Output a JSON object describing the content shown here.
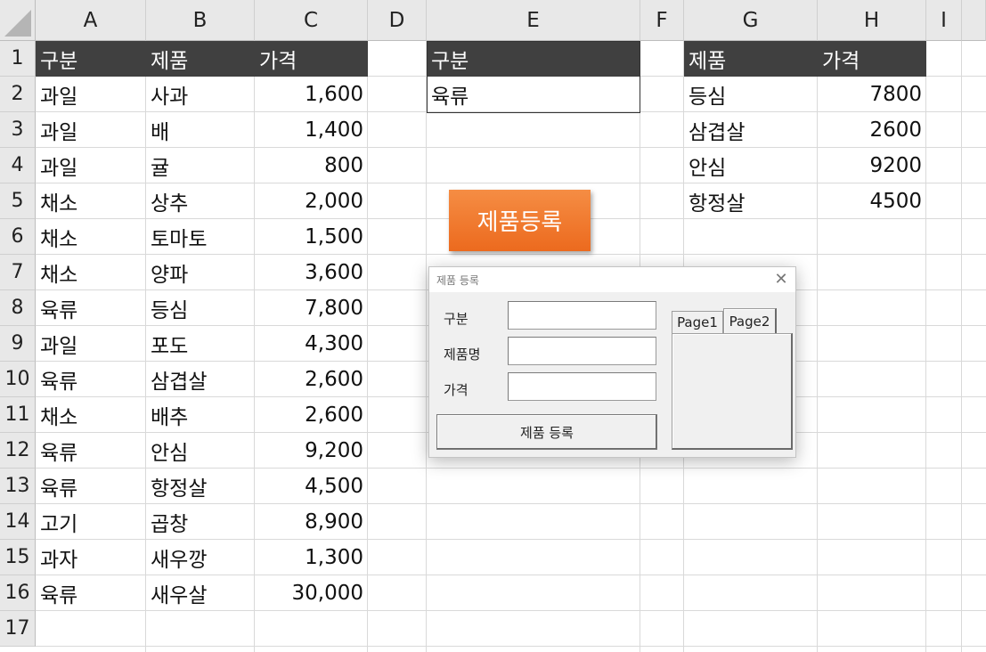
{
  "columns": [
    "A",
    "B",
    "C",
    "D",
    "E",
    "F",
    "G",
    "H",
    "I"
  ],
  "rows": [
    "1",
    "2",
    "3",
    "4",
    "5",
    "6",
    "7",
    "8",
    "9",
    "10",
    "11",
    "12",
    "13",
    "14",
    "15",
    "16",
    "17"
  ],
  "table_main": {
    "headers": [
      "구분",
      "제품",
      "가격"
    ],
    "rows": [
      [
        "과일",
        "사과",
        "1,600"
      ],
      [
        "과일",
        "배",
        "1,400"
      ],
      [
        "과일",
        "귤",
        "800"
      ],
      [
        "채소",
        "상추",
        "2,000"
      ],
      [
        "채소",
        "토마토",
        "1,500"
      ],
      [
        "채소",
        "양파",
        "3,600"
      ],
      [
        "육류",
        "등심",
        "7,800"
      ],
      [
        "과일",
        "포도",
        "4,300"
      ],
      [
        "육류",
        "삼겹살",
        "2,600"
      ],
      [
        "채소",
        "배추",
        "2,600"
      ],
      [
        "육류",
        "안심",
        "9,200"
      ],
      [
        "육류",
        "항정살",
        "4,500"
      ],
      [
        "고기",
        "곱창",
        "8,900"
      ],
      [
        "과자",
        "새우깡",
        "1,300"
      ],
      [
        "육류",
        "새우살",
        "30,000"
      ]
    ]
  },
  "criteria": {
    "header": "구분",
    "value": "육류"
  },
  "result": {
    "headers": [
      "제품",
      "가격"
    ],
    "rows": [
      [
        "등심",
        "7800"
      ],
      [
        "삼겹살",
        "2600"
      ],
      [
        "안심",
        "9200"
      ],
      [
        "항정살",
        "4500"
      ]
    ]
  },
  "macro_button": {
    "label": "제품등록",
    "color": "#ee7127"
  },
  "dialog": {
    "title": "제품 등록",
    "close_glyph": "✕",
    "label_category": "구분",
    "label_product": "제품명",
    "label_price": "가격",
    "category_value": "",
    "product_value": "",
    "price_value": "",
    "submit_label": "제품 등록",
    "tabs": [
      "Page1",
      "Page2"
    ],
    "active_tab": "Page2"
  },
  "colors": {
    "header_fill": "#404040",
    "header_text": "#ffffff",
    "grid": "#d9d9d9"
  }
}
